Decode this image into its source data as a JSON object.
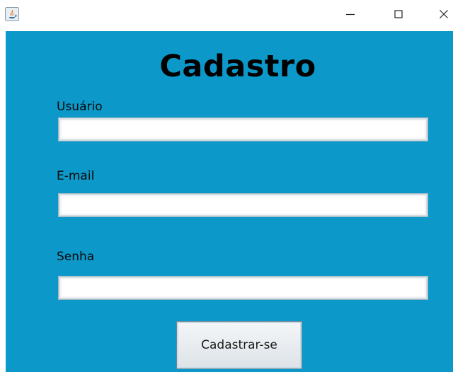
{
  "window": {
    "controls": {
      "minimize_icon": "minimize-icon",
      "maximize_icon": "maximize-icon",
      "close_icon": "close-icon"
    }
  },
  "form": {
    "title": "Cadastro",
    "background_color": "#0c98c9",
    "fields": {
      "username": {
        "label": "Usuário",
        "value": ""
      },
      "email": {
        "label": "E-mail",
        "value": ""
      },
      "password": {
        "label": "Senha",
        "value": ""
      }
    },
    "submit_label": "Cadastrar-se"
  }
}
